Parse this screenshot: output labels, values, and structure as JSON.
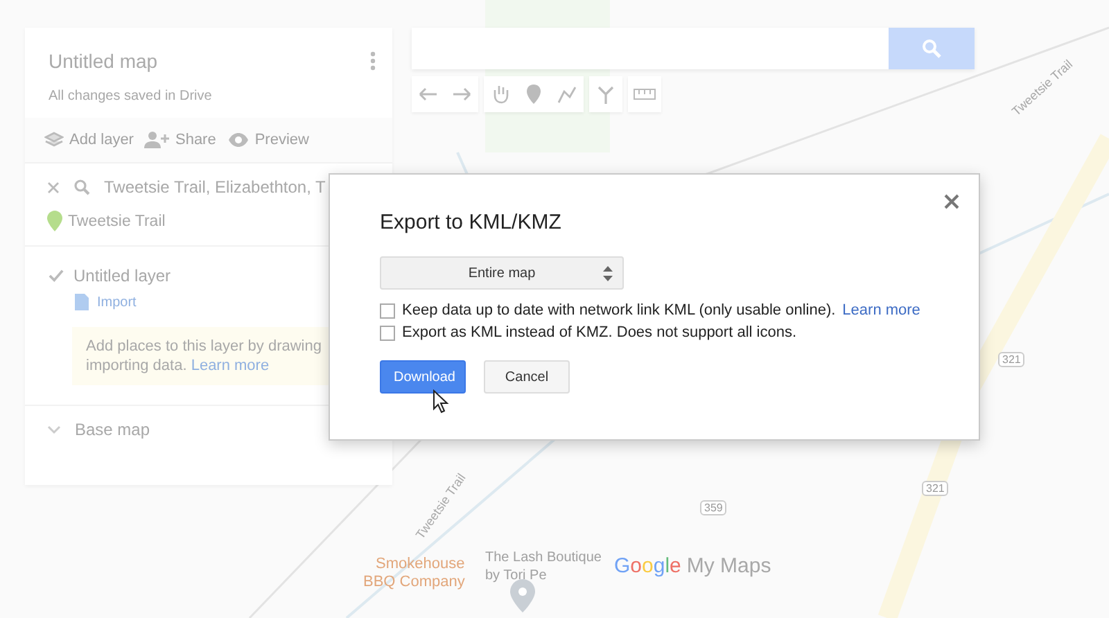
{
  "panel": {
    "title": "Untitled map",
    "subtitle": "All changes saved in Drive",
    "actions": [
      {
        "kind": "layers",
        "label": "Add layer"
      },
      {
        "kind": "share",
        "label": "Share"
      },
      {
        "kind": "preview",
        "label": "Preview"
      }
    ],
    "search_result": {
      "query": "Tweetsie Trail, Elizabethton, T",
      "place": "Tweetsie Trail"
    },
    "layer": {
      "name": "Untitled layer",
      "checked": true,
      "import_label": "Import",
      "hint_lines": [
        "Add places to this layer by drawing",
        "importing data."
      ],
      "hint_link": "Learn more"
    },
    "base_map": "Base map"
  },
  "map_labels": [
    {
      "kind": "trail",
      "text": "Tweetsie Trail"
    },
    {
      "kind": "trail",
      "text": "Tweetsie Trail"
    },
    {
      "kind": "shield",
      "text": "321"
    },
    {
      "kind": "shield",
      "text": "359"
    },
    {
      "kind": "shield",
      "text": "321"
    },
    {
      "kind": "place",
      "text": "The Lash Boutique"
    },
    {
      "kind": "place",
      "text": "by Tori Pe"
    },
    {
      "kind": "food",
      "text": "Smokehouse"
    },
    {
      "kind": "food",
      "text": "BBQ Company"
    }
  ],
  "logo": {
    "brand": "Google",
    "product": "My Maps"
  },
  "dialog": {
    "title": "Export to KML/KMZ",
    "select": "Entire map",
    "options": [
      {
        "label": "Keep data up to date with network link KML (only usable online).",
        "link": "Learn more",
        "checked": false
      },
      {
        "label": "Export as KML instead of KMZ. Does not support all icons.",
        "checked": false
      }
    ],
    "buttons": [
      {
        "kind": "primary",
        "label": "Download"
      },
      {
        "kind": "secondary",
        "label": "Cancel"
      }
    ]
  }
}
